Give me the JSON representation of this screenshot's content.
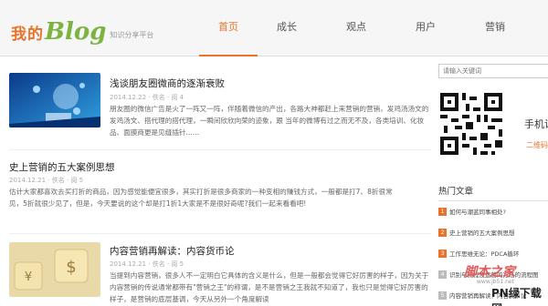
{
  "logo": {
    "cn": "我的",
    "blog": "Blog",
    "subtitle": "知识分享平台"
  },
  "nav": {
    "items": [
      {
        "label": "首页",
        "active": true
      },
      {
        "label": "成长",
        "active": false
      },
      {
        "label": "观点",
        "active": false
      },
      {
        "label": "用户",
        "active": false
      },
      {
        "label": "营销",
        "active": false
      }
    ]
  },
  "articles": [
    {
      "title": "浅谈朋友圈微商的逐渐衰败",
      "meta": "2014.12.22  ·  佚名  ·  阅 4",
      "summary": "朋友圈的微信广告是火了一阵又一阵，伴随着微信的产出，各路大神都赶上来营销的营销，发鸡汤汤文的发鸡汤文、搭代理的搭代理，一瞬间欣欣向荣的迹象，跟 当年的微博有过之而无不及，各类培训、化妆品、面膜商更是见缝插针......"
    },
    {
      "title": "史上营销的五大案例思想",
      "meta": "2014.12.21  ·  佚名  ·  阅 5",
      "summary": "估计大家都喜欢去买打折的商品，因为感觉能便宜很多，其实打折是很多商家的一种变相的赚钱方式，一般都是打7、8折很常见，5折就很少见了，但是，今天要说的这个却是打1折1大家是不是很好奇呢?我们一起来看看吧!"
    },
    {
      "title": "内容营销再解读：内容货币论",
      "meta": "2014.12.21  ·  佚名  ·  阅 5",
      "summary": "当提到内容营销，很多人不一定明白它具体的含义是什么，但是一般都会觉得它好厉害的样子，因为关于内容营销的传说通常都带有\"营销之王\"的称谓，是不是营销之王我就不知道了，我也只是觉得它好厉害的样子，是营销的底层基调，今天从另外一个角度解读"
    }
  ],
  "sidebar": {
    "search_placeholder": "请输入关键词",
    "phone_title": "手机访问",
    "phone_sub": "二维码",
    "hot_title": "热门文章",
    "hot_items": [
      {
        "num": "1",
        "label": "如何与潮蓝同事相处?",
        "color": "#e8742c"
      },
      {
        "num": "2",
        "label": "史上营销的五大案例思想",
        "color": "#e8742c"
      },
      {
        "num": "3",
        "label": "工作思维无论：PDCA循环",
        "color": "#e8742c"
      },
      {
        "num": "4",
        "label": "识别与流程及运营的方法的流程图",
        "color": "#bbb"
      },
      {
        "num": "5",
        "label": "内容营销再解读：内容货币论",
        "color": "#bbb"
      }
    ]
  },
  "watermark": {
    "line1": "脚本之家",
    "line2": "PN绿下载网",
    "line3": "www.jb51.net"
  }
}
